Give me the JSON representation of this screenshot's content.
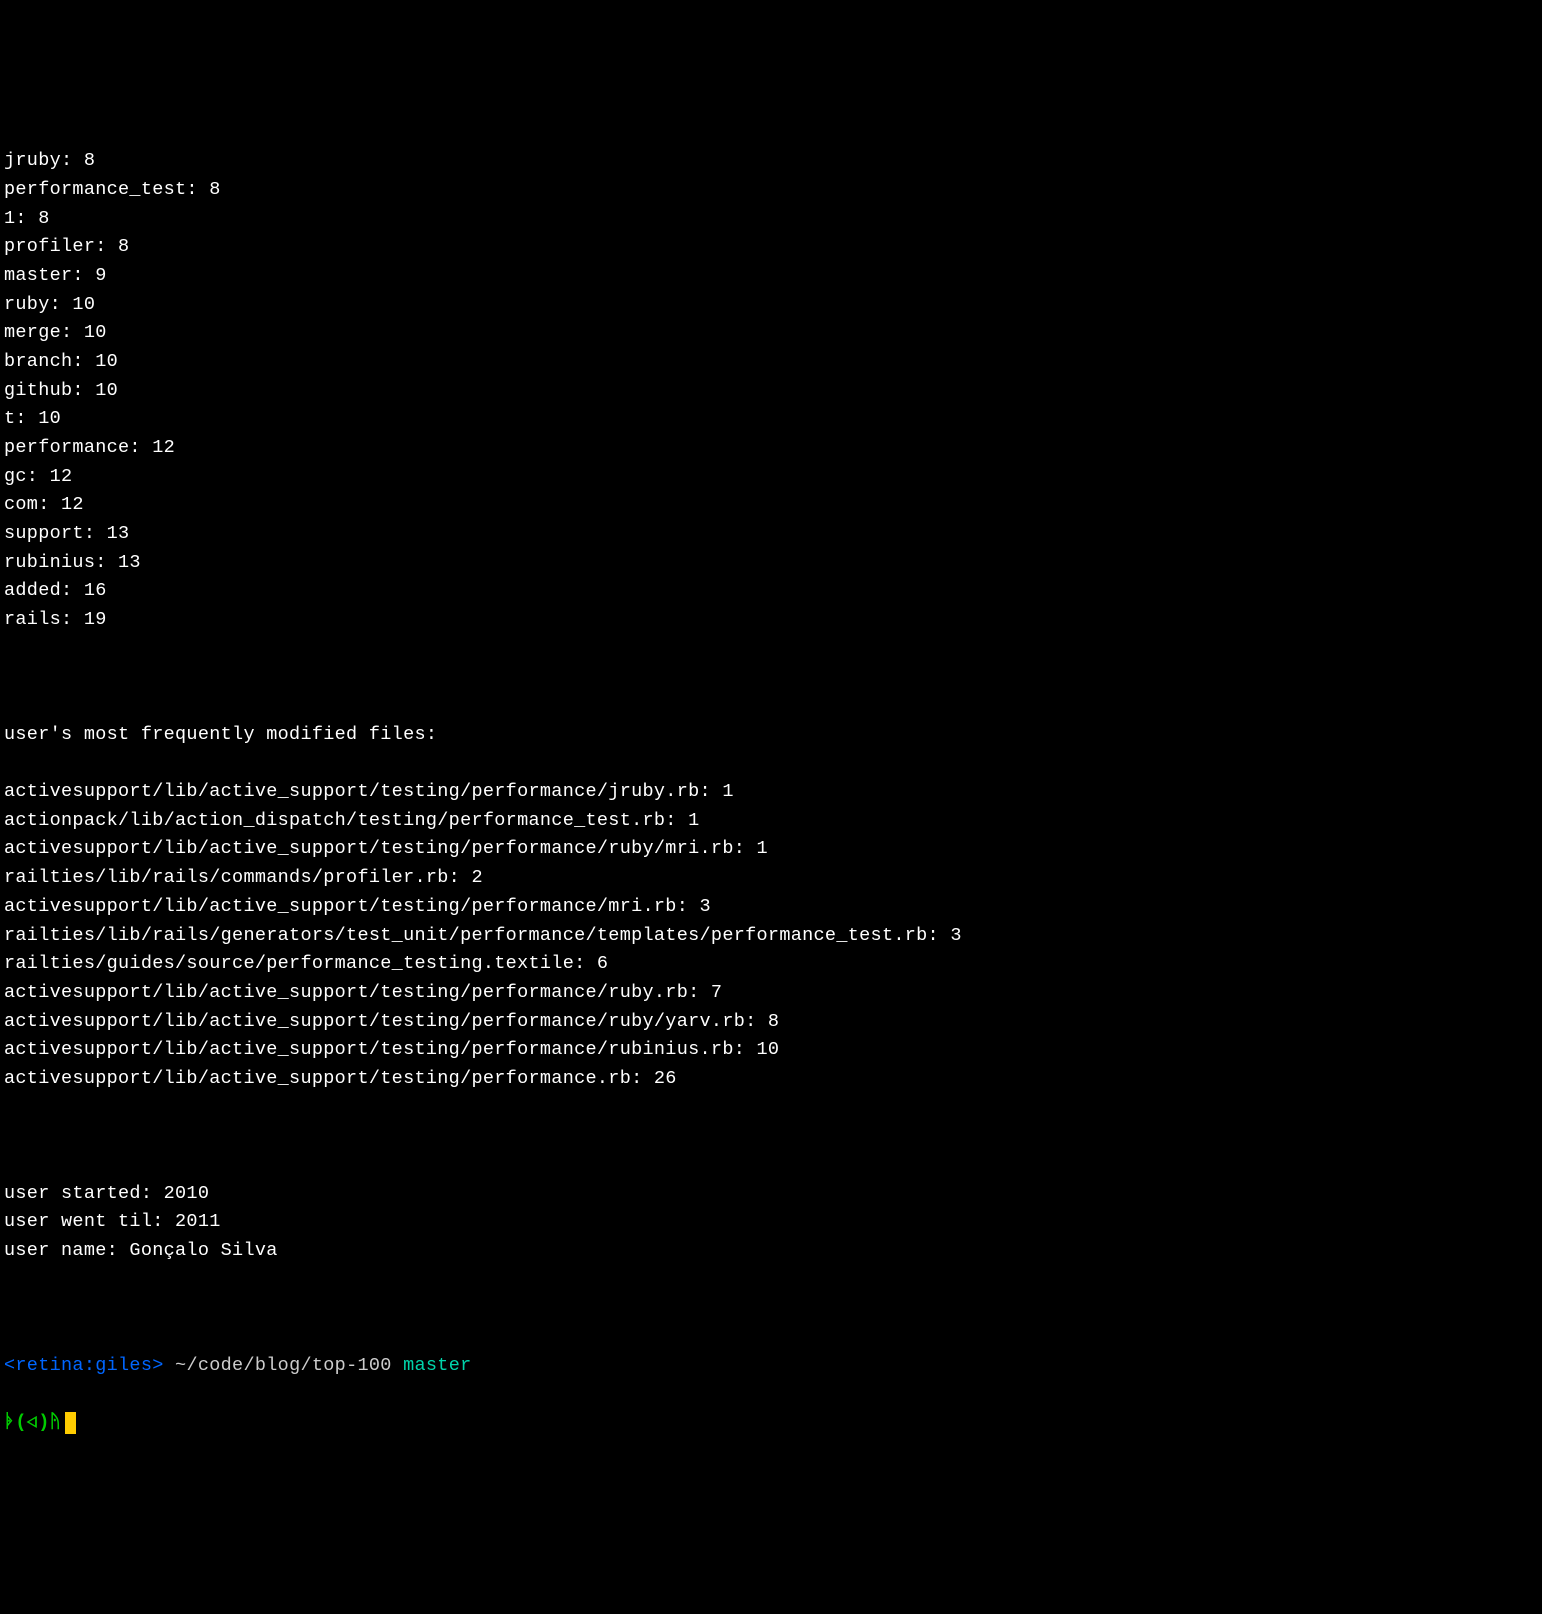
{
  "word_counts": [
    {
      "word": "jruby",
      "count": 8
    },
    {
      "word": "performance_test",
      "count": 8
    },
    {
      "word": "1",
      "count": 8
    },
    {
      "word": "profiler",
      "count": 8
    },
    {
      "word": "master",
      "count": 9
    },
    {
      "word": "ruby",
      "count": 10
    },
    {
      "word": "merge",
      "count": 10
    },
    {
      "word": "branch",
      "count": 10
    },
    {
      "word": "github",
      "count": 10
    },
    {
      "word": "t",
      "count": 10
    },
    {
      "word": "performance",
      "count": 12
    },
    {
      "word": "gc",
      "count": 12
    },
    {
      "word": "com",
      "count": 12
    },
    {
      "word": "support",
      "count": 13
    },
    {
      "word": "rubinius",
      "count": 13
    },
    {
      "word": "added",
      "count": 16
    },
    {
      "word": "rails",
      "count": 19
    }
  ],
  "files_header": "user's most frequently modified files:",
  "files": [
    {
      "path": "activesupport/lib/active_support/testing/performance/jruby.rb",
      "count": 1
    },
    {
      "path": "actionpack/lib/action_dispatch/testing/performance_test.rb",
      "count": 1
    },
    {
      "path": "activesupport/lib/active_support/testing/performance/ruby/mri.rb",
      "count": 1
    },
    {
      "path": "railties/lib/rails/commands/profiler.rb",
      "count": 2
    },
    {
      "path": "activesupport/lib/active_support/testing/performance/mri.rb",
      "count": 3
    },
    {
      "path": "railties/lib/rails/generators/test_unit/performance/templates/performance_test.rb",
      "count": 3
    },
    {
      "path": "railties/guides/source/performance_testing.textile",
      "count": 6
    },
    {
      "path": "activesupport/lib/active_support/testing/performance/ruby.rb",
      "count": 7
    },
    {
      "path": "activesupport/lib/active_support/testing/performance/ruby/yarv.rb",
      "count": 8
    },
    {
      "path": "activesupport/lib/active_support/testing/performance/rubinius.rb",
      "count": 10
    },
    {
      "path": "activesupport/lib/active_support/testing/performance.rb",
      "count": 26
    }
  ],
  "user_info": [
    {
      "label": "user started",
      "value": "2010"
    },
    {
      "label": "user went til",
      "value": "2011"
    },
    {
      "label": "user name",
      "value": "Gonçalo Silva"
    }
  ],
  "prompt": {
    "host": "<retina:giles>",
    "path": "~/code/blog/top-100",
    "branch": "master",
    "symbols": "ᚧ(◁)ᚤ"
  }
}
